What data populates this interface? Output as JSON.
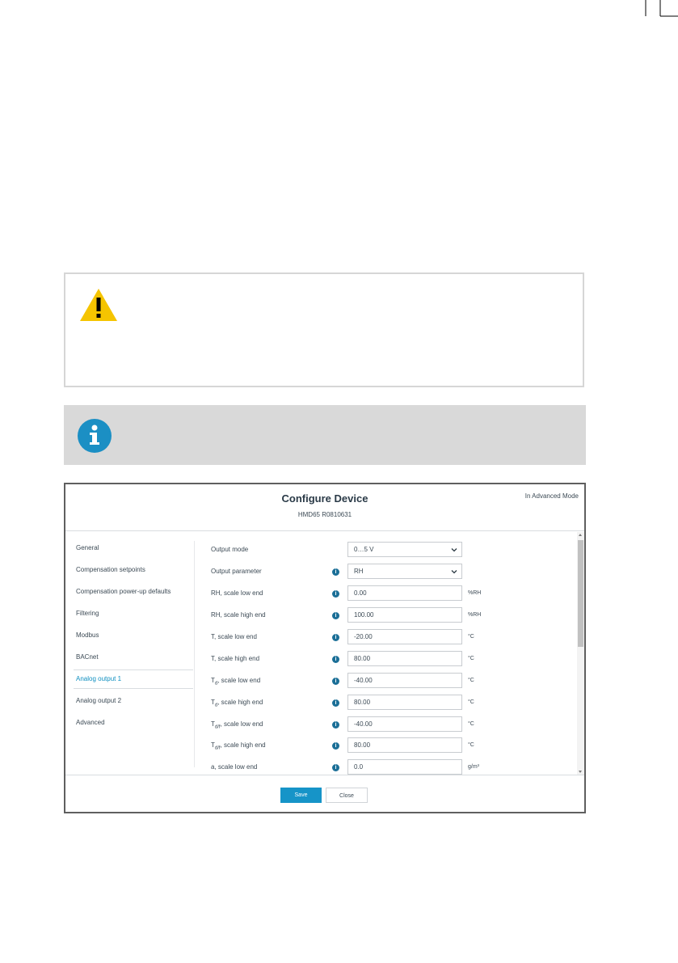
{
  "dialog": {
    "title": "Configure Device",
    "subtitle": "HMD65 R0810631",
    "mode": "In Advanced Mode"
  },
  "sidebar": {
    "items": [
      {
        "label": "General"
      },
      {
        "label": "Compensation setpoints"
      },
      {
        "label": "Compensation power-up defaults"
      },
      {
        "label": "Filtering"
      },
      {
        "label": "Modbus"
      },
      {
        "label": "BACnet"
      },
      {
        "label": "Analog output 1",
        "active": true
      },
      {
        "label": "Analog output 2"
      },
      {
        "label": "Advanced"
      }
    ]
  },
  "form": {
    "rows": [
      {
        "label": "Output mode",
        "value": "0…5 V",
        "type": "select",
        "info": false,
        "unit": ""
      },
      {
        "label": "Output parameter",
        "value": "RH",
        "type": "select",
        "info": true,
        "unit": ""
      },
      {
        "label": "RH, scale low end",
        "value": "0.00",
        "type": "input",
        "info": true,
        "unit": "%RH"
      },
      {
        "label": "RH, scale high end",
        "value": "100.00",
        "type": "input",
        "info": true,
        "unit": "%RH"
      },
      {
        "label": "T, scale low end",
        "value": "-20.00",
        "type": "input",
        "info": true,
        "unit": "°C"
      },
      {
        "label": "T, scale high end",
        "value": "80.00",
        "type": "input",
        "info": true,
        "unit": "°C"
      },
      {
        "label_main": "T",
        "label_sub": "d",
        "label_rest": ", scale low end",
        "value": "-40.00",
        "type": "input",
        "info": true,
        "unit": "°C"
      },
      {
        "label_main": "T",
        "label_sub": "d",
        "label_rest": ", scale high end",
        "value": "80.00",
        "type": "input",
        "info": true,
        "unit": "°C"
      },
      {
        "label_main": "T",
        "label_sub": "d/f",
        "label_rest": ", scale low end",
        "value": "-40.00",
        "type": "input",
        "info": true,
        "unit": "°C"
      },
      {
        "label_main": "T",
        "label_sub": "d/f",
        "label_rest": ", scale high end",
        "value": "80.00",
        "type": "input",
        "info": true,
        "unit": "°C"
      },
      {
        "label": "a, scale low end",
        "value": "0.0",
        "type": "input",
        "info": true,
        "unit": "g/m³"
      }
    ]
  },
  "footer": {
    "save_label": "Save",
    "close_label": "Close"
  },
  "colors": {
    "accent": "#1694c8",
    "warning": "#f5c400",
    "info_icon": "#1b8fc4"
  },
  "icons": [
    "warning-icon",
    "info-icon",
    "chevron-down-icon"
  ]
}
